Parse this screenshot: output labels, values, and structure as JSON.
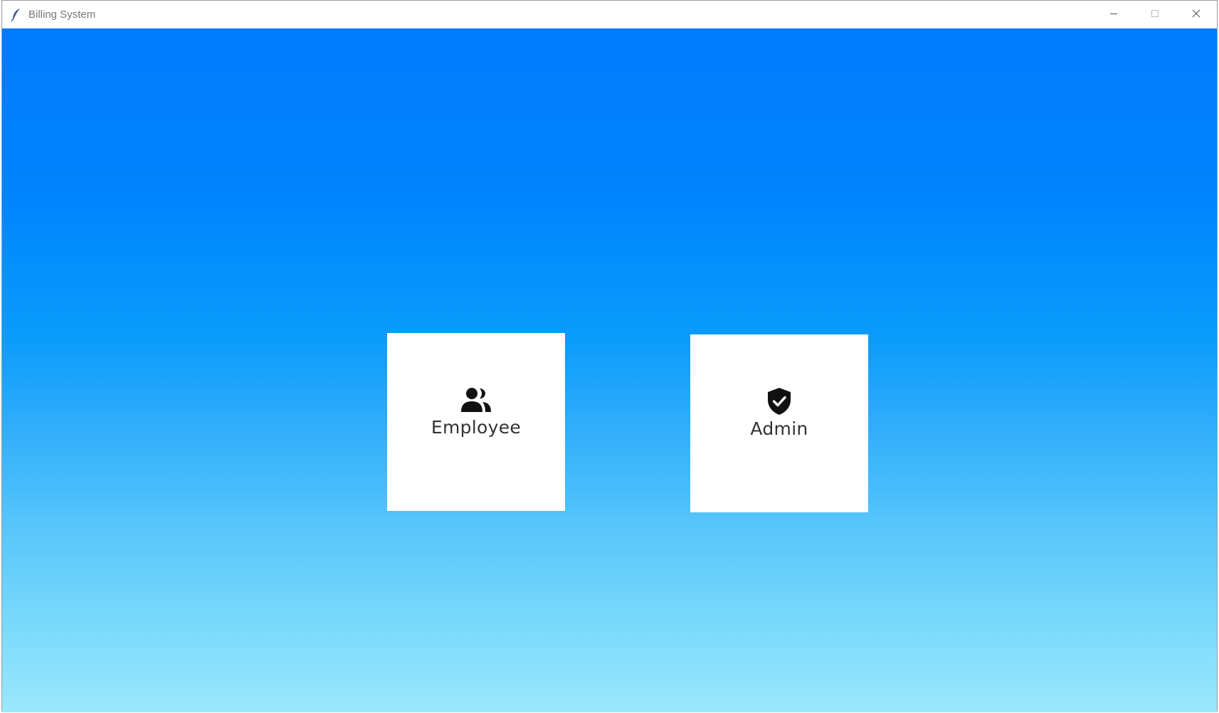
{
  "window": {
    "title": "Billing System",
    "app_icon": "feather-icon",
    "controls": {
      "minimize_icon": "minimize-icon",
      "maximize_icon": "maximize-icon",
      "close_icon": "close-icon"
    }
  },
  "background": {
    "gradient_top": "#007bff",
    "gradient_bottom": "#9ae8fd"
  },
  "cards": [
    {
      "label": "Employee",
      "icon": "users-icon"
    },
    {
      "label": "Admin",
      "icon": "shield-check-icon"
    }
  ]
}
